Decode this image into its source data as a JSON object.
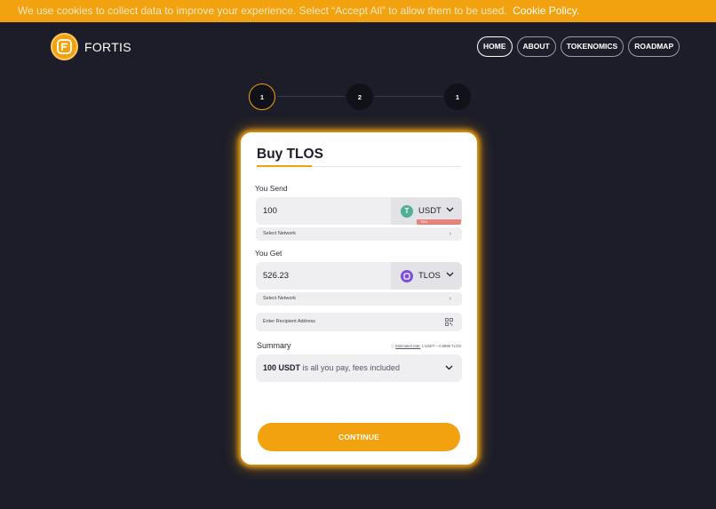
{
  "cookie_bar": {
    "message": "We use cookies to collect data to improve your experience. Select “Accept All” to allow them to be used.",
    "link": "Cookie Policy."
  },
  "brand": {
    "name": "FORTIS",
    "icon": "fortis-logo-icon",
    "accent": "#f2a10f"
  },
  "nav": {
    "items": [
      {
        "label": "HOME",
        "active": true
      },
      {
        "label": "ABOUT"
      },
      {
        "label": "TOKENOMICS"
      },
      {
        "label": "ROADMAP"
      }
    ]
  },
  "stepper": {
    "steps": [
      "1",
      "2",
      "1"
    ],
    "current": 1
  },
  "form": {
    "title": "Buy TLOS",
    "send": {
      "label": "You Send",
      "amount": "100",
      "coin": "USDT",
      "coin_icon": "tether-icon",
      "coin_color": "#50af95",
      "network_placeholder": "Select Network",
      "network_tag": "TRX"
    },
    "get": {
      "label": "You Get",
      "amount": "526.23",
      "coin": "TLOS",
      "coin_icon": "telos-icon",
      "coin_color": "#7b4fd6",
      "network_placeholder": "Select Network"
    },
    "recipient_placeholder": "Enter Recipient Address",
    "summary": {
      "label": "Summary",
      "rate_prefix": "Estimated rate:",
      "rate_value": "1 USDT ~ 0.9899 TLOS",
      "amount_bold": "100 USDT",
      "amount_text": "is all you pay, fees included"
    },
    "continue_label": "CONTINUE"
  }
}
